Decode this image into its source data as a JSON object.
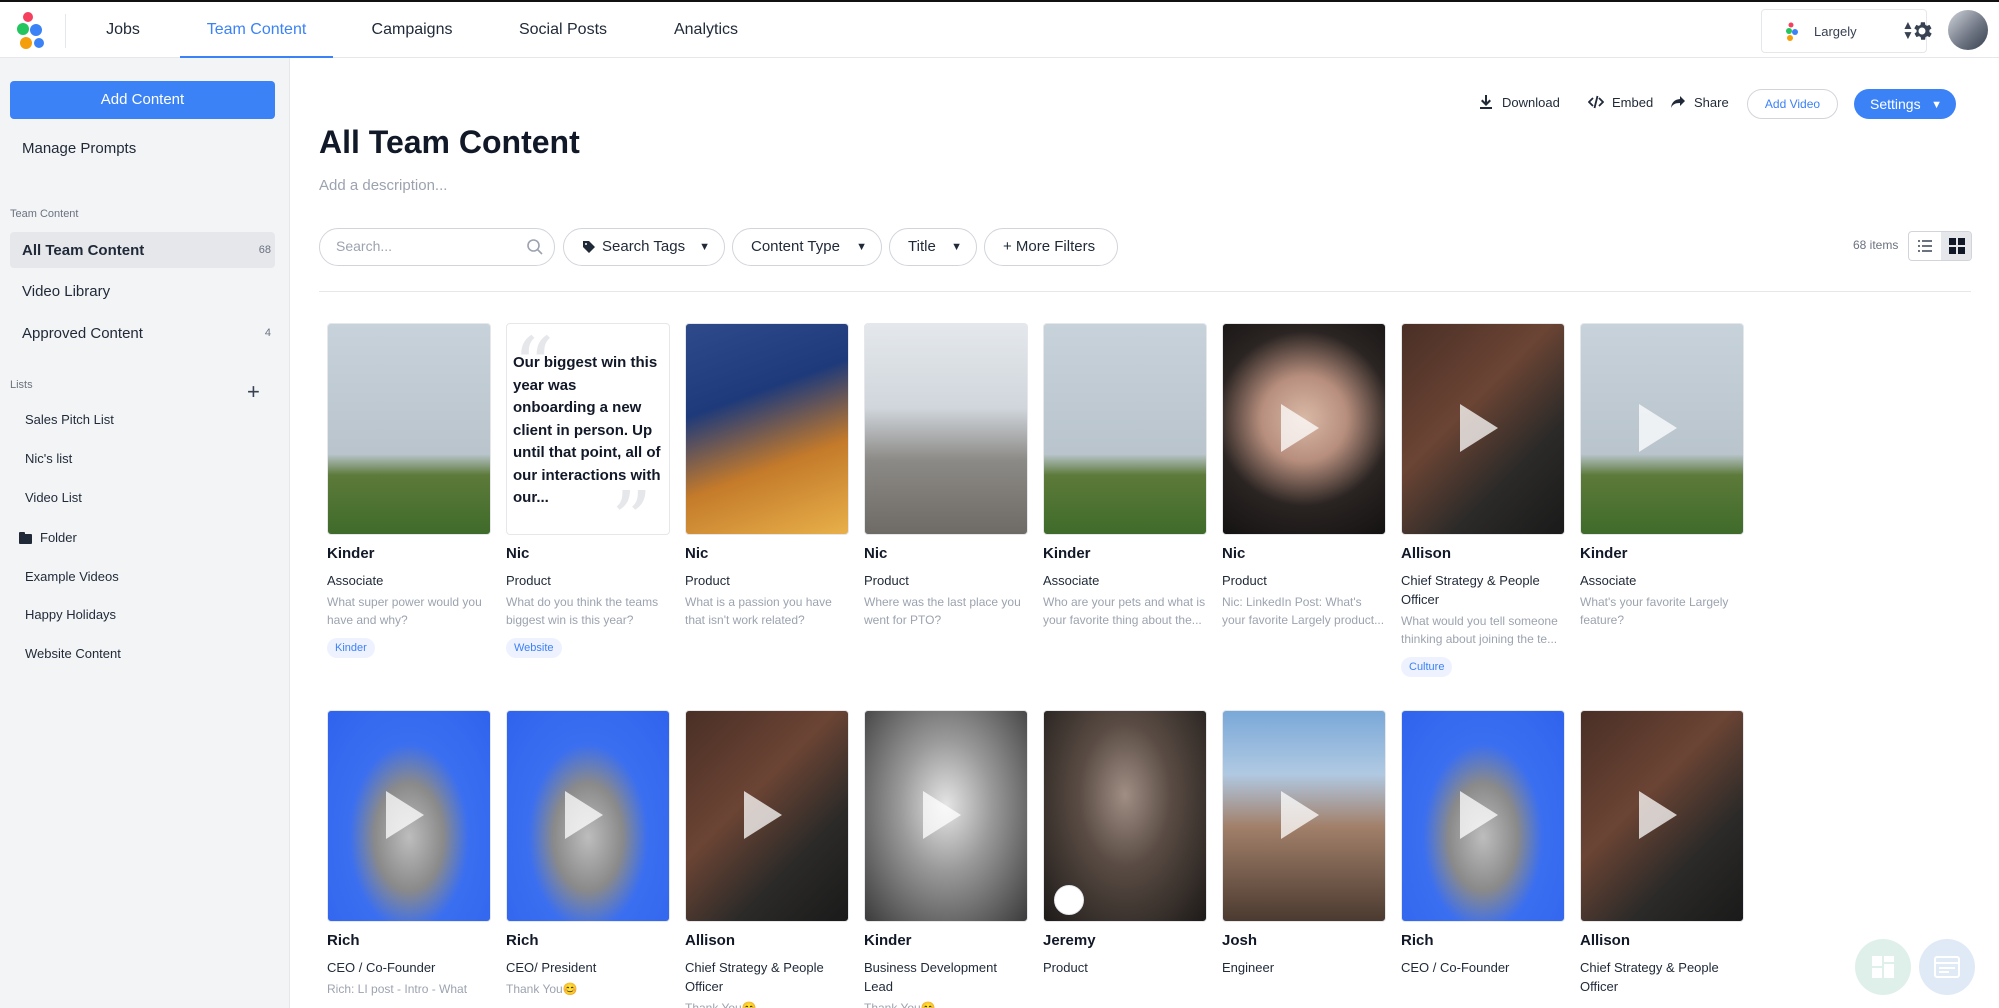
{
  "nav": {
    "tabs": [
      "Jobs",
      "Team Content",
      "Campaigns",
      "Social Posts",
      "Analytics"
    ],
    "active_tab": "Team Content",
    "org_name": "Largely"
  },
  "colors": {
    "accent": "#3b82f6"
  },
  "sidebar": {
    "add_content_label": "Add Content",
    "manage_prompts_label": "Manage Prompts",
    "team_content_heading": "Team Content",
    "team_items": [
      {
        "label": "All Team Content",
        "count": "68"
      },
      {
        "label": "Video Library",
        "count": ""
      },
      {
        "label": "Approved Content",
        "count": "4"
      }
    ],
    "lists_heading": "Lists",
    "lists": [
      "Sales Pitch List",
      "Nic's list",
      "Video List",
      "Folder",
      "Example Videos",
      "Happy Holidays",
      "Website Content"
    ]
  },
  "header": {
    "title": "All Team Content",
    "description_placeholder": "Add a description...",
    "download_label": "Download",
    "embed_label": "Embed",
    "share_label": "Share",
    "add_video_label": "Add Video",
    "settings_label": "Settings"
  },
  "filters": {
    "search_placeholder": "Search...",
    "search_tags_label": "Search Tags",
    "content_type_label": "Content Type",
    "title_label": "Title",
    "more_filters_label": "+ More Filters",
    "item_count": "68 items"
  },
  "cards": [
    {
      "name": "Kinder",
      "role": "Associate",
      "prompt": "What super power would you have and why?",
      "tag": "Kinder",
      "thumb": "golfer",
      "video": false
    },
    {
      "name": "Nic",
      "role": "Product",
      "prompt": "What do you think the teams biggest win is this year?",
      "tag": "Website",
      "thumb": "quote",
      "quote": "Our biggest win this year was onboarding a new client in person. Up until that point, all of our interactions with our...",
      "video": false
    },
    {
      "name": "Nic",
      "role": "Product",
      "prompt": "What is a passion you have that isn't work related?",
      "tag": "",
      "thumb": "food",
      "video": false
    },
    {
      "name": "Nic",
      "role": "Product",
      "prompt": "Where was the last place you went for PTO?",
      "tag": "",
      "thumb": "city",
      "video": false
    },
    {
      "name": "Kinder",
      "role": "Associate",
      "prompt": "Who are your pets and what is your favorite thing about the...",
      "tag": "",
      "thumb": "golfer",
      "video": false
    },
    {
      "name": "Nic",
      "role": "Product",
      "prompt": "Nic: LinkedIn Post: What's your favorite Largely product...",
      "tag": "",
      "thumb": "portrait-dark",
      "video": true
    },
    {
      "name": "Allison",
      "role": "Chief Strategy & People Officer",
      "prompt": "What would you tell someone thinking about joining the te...",
      "tag": "Culture",
      "thumb": "horse",
      "video": true
    },
    {
      "name": "Kinder",
      "role": "Associate",
      "prompt": "What's your favorite Largely feature?",
      "tag": "",
      "thumb": "golfer",
      "video": true
    },
    {
      "name": "Rich",
      "role": "CEO / Co-Founder",
      "prompt": "Rich: LI post - Intro - What makes you most excited ab...",
      "tag": "",
      "thumb": "blue",
      "video": true
    },
    {
      "name": "Rich",
      "role": "CEO/ President",
      "prompt": "Thank You😊",
      "tag": "",
      "thumb": "blue",
      "video": true
    },
    {
      "name": "Allison",
      "role": "Chief Strategy & People Officer",
      "prompt": "Thank You😊",
      "tag": "",
      "thumb": "horse",
      "video": true
    },
    {
      "name": "Kinder",
      "role": "Business Development Lead",
      "prompt": "Thank You😊",
      "tag": "",
      "thumb": "bw",
      "video": true
    },
    {
      "name": "Jeremy",
      "role": "Product",
      "prompt": "",
      "tag": "",
      "thumb": "jeremy",
      "video": false
    },
    {
      "name": "Josh",
      "role": "Engineer",
      "prompt": "",
      "tag": "",
      "thumb": "couple",
      "video": true
    },
    {
      "name": "Rich",
      "role": "CEO / Co-Founder",
      "prompt": "",
      "tag": "",
      "thumb": "blue",
      "video": true
    },
    {
      "name": "Allison",
      "role": "Chief Strategy & People Officer",
      "prompt": "",
      "tag": "",
      "thumb": "horse",
      "video": true
    }
  ]
}
